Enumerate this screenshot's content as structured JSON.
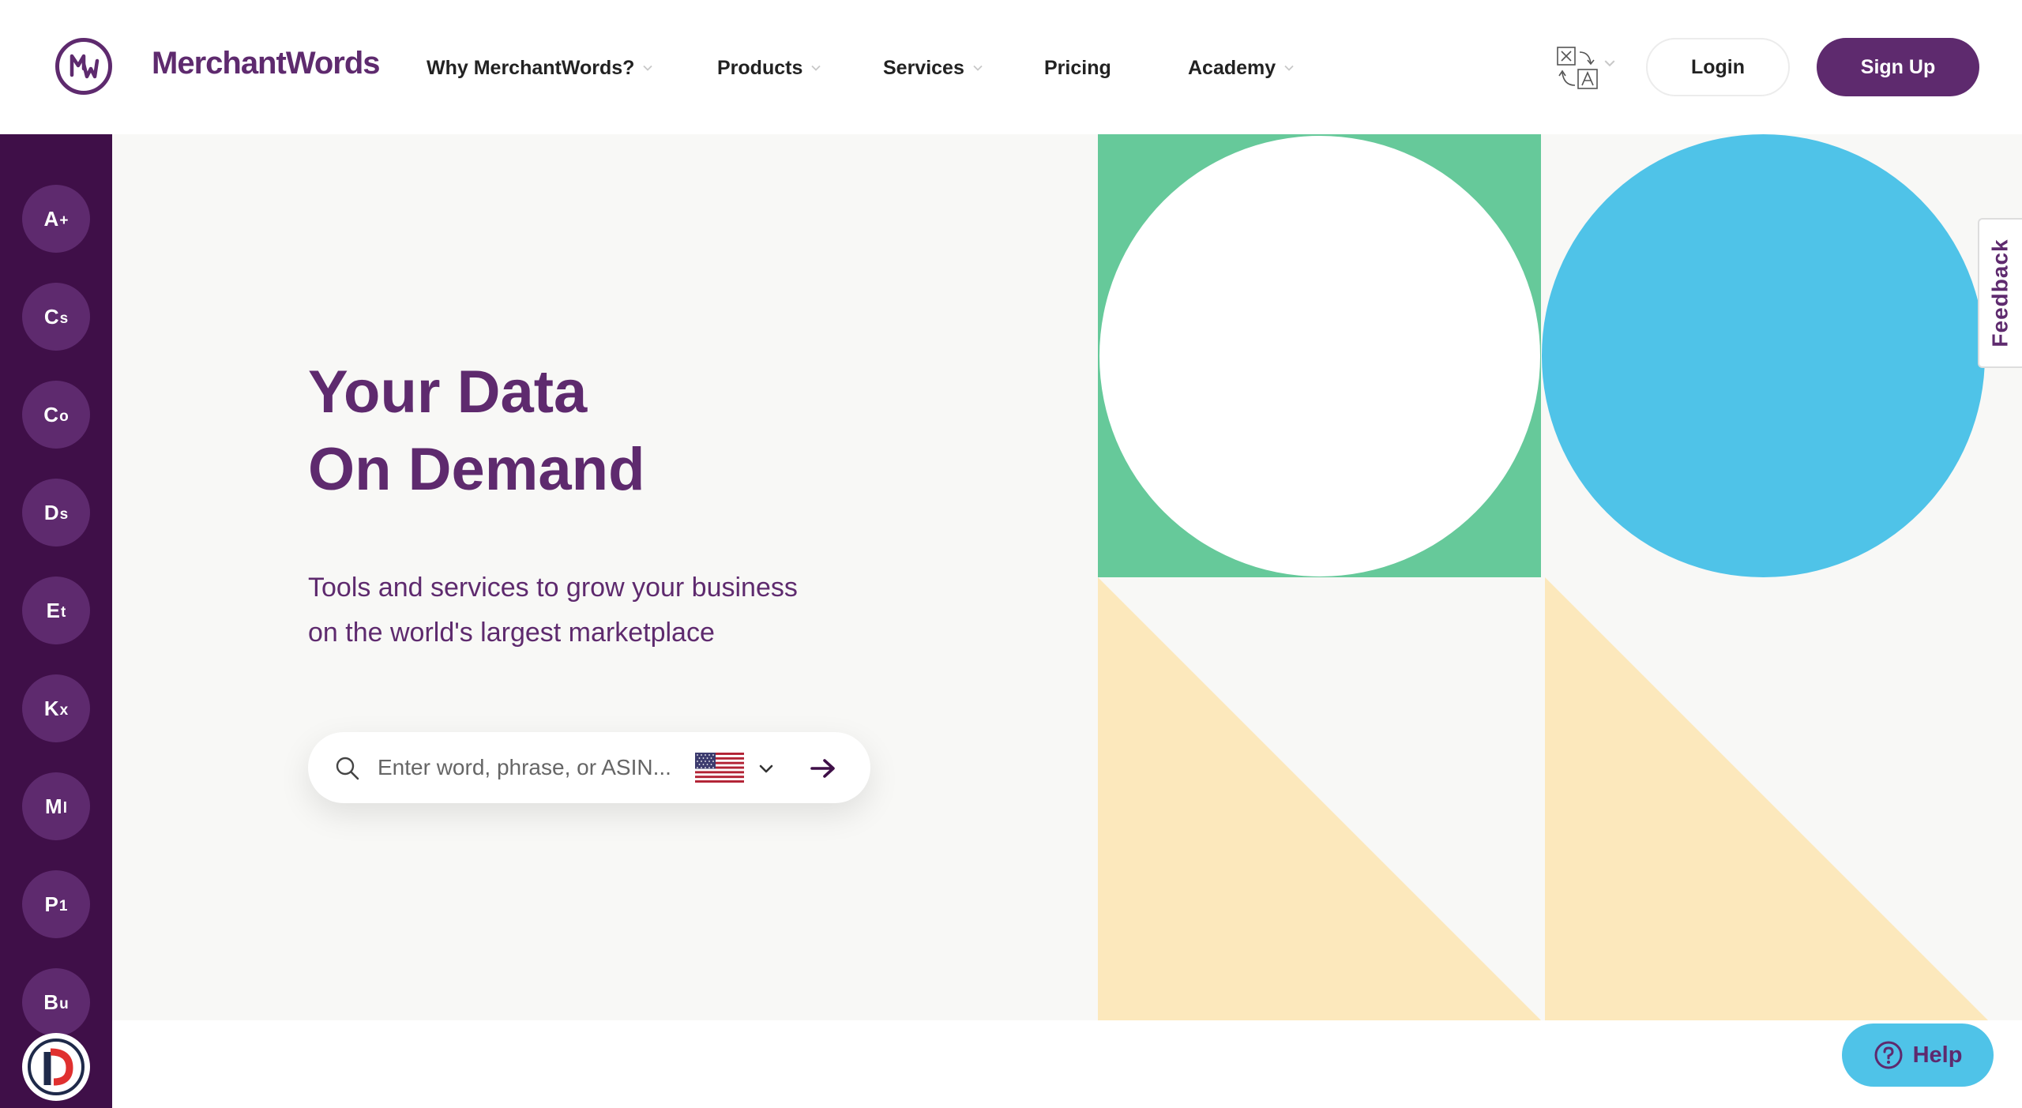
{
  "brand": {
    "name": "MerchantWords",
    "color": "#5e2a6e"
  },
  "nav": {
    "why": "Why MerchantWords?",
    "products": "Products",
    "services": "Services",
    "pricing": "Pricing",
    "academy": "Academy"
  },
  "header": {
    "login_label": "Login",
    "signup_label": "Sign Up"
  },
  "rail": {
    "items": [
      {
        "main": "A",
        "sub": "+"
      },
      {
        "main": "C",
        "sub": "s"
      },
      {
        "main": "C",
        "sub": "o"
      },
      {
        "main": "D",
        "sub": "s"
      },
      {
        "main": "E",
        "sub": "t"
      },
      {
        "main": "K",
        "sub": "x"
      },
      {
        "main": "M",
        "sub": "l"
      },
      {
        "main": "P",
        "sub": "1"
      },
      {
        "main": "B",
        "sub": "u"
      }
    ]
  },
  "hero": {
    "title_line1": "Your Data",
    "title_line2": "On Demand",
    "subtitle_line1": "Tools and services to grow your business",
    "subtitle_line2": "on the world's largest marketplace"
  },
  "search": {
    "placeholder": "Enter word, phrase, or ASIN...",
    "value": ""
  },
  "feedback": {
    "label": "Feedback"
  },
  "help": {
    "label": "Help"
  },
  "colors": {
    "purple": "#5e2a6e",
    "rail": "#3f0f48",
    "green": "#66c99a",
    "blue": "#4fc3e8",
    "cream": "#fce8bc",
    "hero_bg": "#f8f8f6"
  },
  "icons": [
    "mw-logo-icon",
    "chevron-down-icon",
    "translate-icon",
    "search-icon",
    "us-flag-icon",
    "arrow-right-icon",
    "help-circle-icon",
    "brand-badge-icon"
  ]
}
